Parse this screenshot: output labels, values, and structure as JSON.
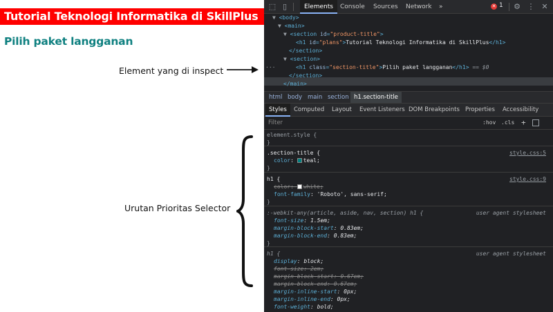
{
  "page": {
    "title": "Tutorial Teknologi Informatika di SkillPlus",
    "subtitle": "Pilih paket langganan",
    "annotation_inspect": "Element yang di inspect",
    "annotation_priority": "Urutan Prioritas Selector",
    "title_bg": "#ff0000",
    "subtitle_color": "#008080"
  },
  "toolbar": {
    "tabs": [
      "Elements",
      "Console",
      "Sources",
      "Network"
    ],
    "more": "»",
    "error_count": "1",
    "icons": [
      "inspect-icon",
      "device-toolbar-icon",
      "settings-icon",
      "more-icon",
      "close-icon"
    ]
  },
  "dom": {
    "body_open": "<body>",
    "main_open": "<main>",
    "section_open_1": "<section id=\"product-title\">",
    "h1_plans": "<h1 id=\"plans\">Tutorial Teknologi Informatika di SkillPlus</h1>",
    "section_close_1": "</section>",
    "section_open_2": "<section>",
    "h1_selected": "<h1 class=\"section-title\">Pilih paket langganan</h1>",
    "selected_ref": "== $0",
    "section_close_2": "</section>",
    "main_close": "</main>"
  },
  "breadcrumbs": [
    "html",
    "body",
    "main",
    "section",
    "h1.section-title"
  ],
  "subtabs": [
    "Styles",
    "Computed",
    "Layout",
    "Event Listeners",
    "DOM Breakpoints",
    "Properties",
    "Accessibility"
  ],
  "filter": {
    "placeholder": "Filter",
    "hov": ":hov",
    "cls": ".cls",
    "plus": "+"
  },
  "styles": {
    "element_style": "element.style {",
    "close": "}",
    "rule1_selector": ".section-title {",
    "rule1_source": "style.css:5",
    "rule1_prop": "color",
    "rule1_value": "teal;",
    "rule2_selector": "h1 {",
    "rule2_source": "style.css:9",
    "rule2_prop1": "color",
    "rule2_val1": "white;",
    "rule2_prop2": "font-family",
    "rule2_val2": "'Roboto', sans-serif;",
    "rule3_selector": ":-webkit-any(article, aside, nav, section) h1 {",
    "rule3_source": "user agent stylesheet",
    "rule3_props": [
      {
        "p": "font-size",
        "v": "1.5em;"
      },
      {
        "p": "margin-block-start",
        "v": "0.83em;"
      },
      {
        "p": "margin-block-end",
        "v": "0.83em;"
      }
    ],
    "rule4_selector": "h1 {",
    "rule4_source": "user agent stylesheet",
    "rule4_props": [
      {
        "p": "display",
        "v": "block;"
      },
      {
        "p": "font-size",
        "v": "2em;"
      },
      {
        "p": "margin-block-start",
        "v": "0.67em;"
      },
      {
        "p": "margin-block-end",
        "v": "0.67em;"
      },
      {
        "p": "margin-inline-start",
        "v": "0px;"
      },
      {
        "p": "margin-inline-end",
        "v": "0px;"
      },
      {
        "p": "font-weight",
        "v": "bold;"
      }
    ],
    "teal_color": "#008080",
    "white_color": "#ffffff"
  }
}
